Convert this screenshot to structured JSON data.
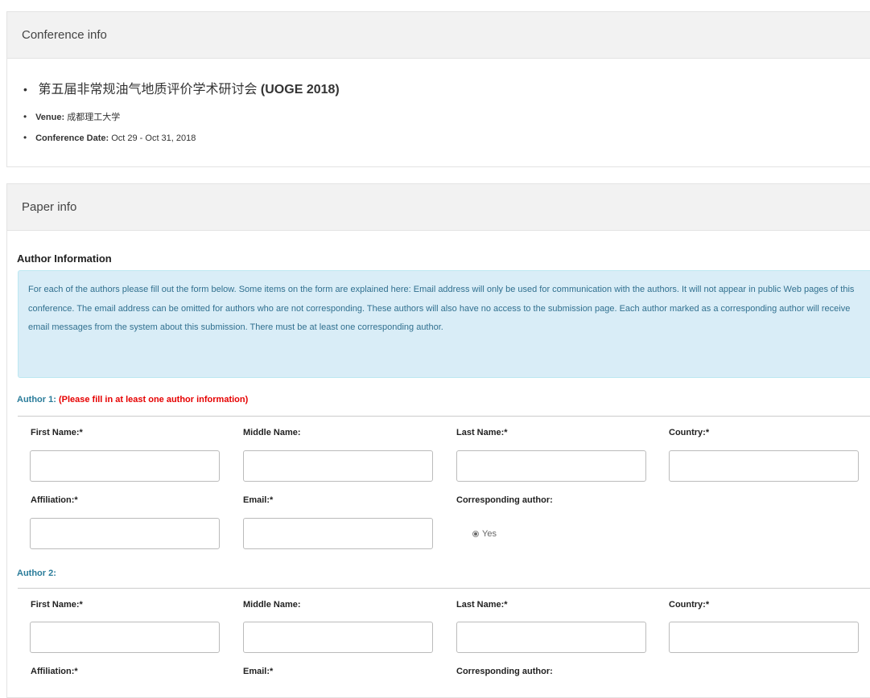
{
  "conference_panel": {
    "heading": "Conference info",
    "name": "第五届非常规油气地质评价学术研讨会",
    "abbr": "(UOGE 2018)",
    "venue_label": "Venue:",
    "venue_value": "成都理工大学",
    "date_label": "Conference Date:",
    "date_value": "Oct 29 - Oct 31, 2018"
  },
  "paper_panel": {
    "heading": "Paper info",
    "section_title": "Author Information",
    "info_text": "For each of the authors please fill out the form below. Some items on the form are explained here: Email address will only be used for communication with the authors. It will not appear in public Web pages of this conference. The email address can be omitted for authors who are not corresponding. These authors will also have no access to the submission page. Each author marked as a corresponding author will receive email messages from the system about this submission. There must be at least one corresponding author."
  },
  "field_labels": {
    "first_name": "First Name:*",
    "middle_name": "Middle Name:",
    "last_name": "Last Name:*",
    "country": "Country:*",
    "affiliation": "Affiliation:*",
    "email": "Email:*",
    "corresponding": "Corresponding author:"
  },
  "authors": [
    {
      "label": "Author 1:",
      "note": "(Please fill in at least one author information)",
      "first_name": "",
      "middle_name": "",
      "last_name": "",
      "country": "",
      "affiliation": "",
      "email": "",
      "corresponding_option": "Yes"
    },
    {
      "label": "Author 2:",
      "note": "",
      "first_name": "",
      "middle_name": "",
      "last_name": "",
      "country": "",
      "affiliation": "",
      "email": ""
    }
  ]
}
